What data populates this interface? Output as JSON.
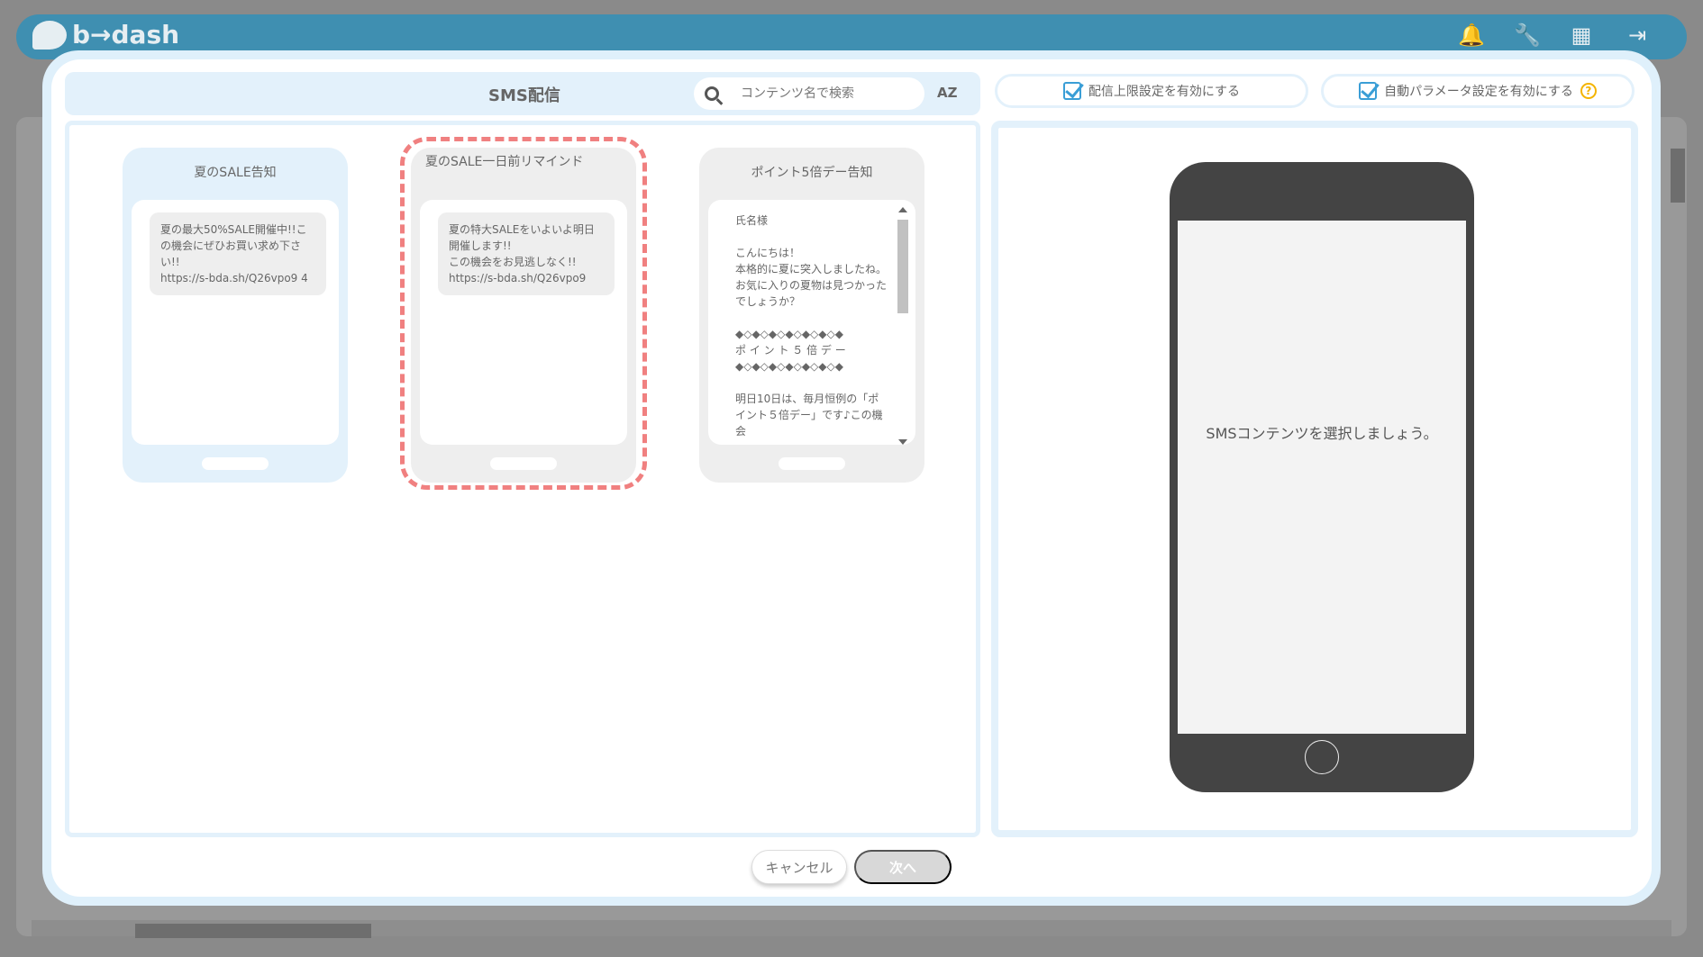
{
  "app": {
    "logo_text": "b→dash"
  },
  "modal": {
    "title": "SMS配信",
    "search": {
      "placeholder": "コンテンツ名で検索",
      "value": ""
    },
    "sort_label": "AZ",
    "toggles": [
      {
        "label": "配信上限設定を有効にする",
        "checked": true
      },
      {
        "label": "自動パラメータ設定を有効にする",
        "checked": true,
        "help": "?"
      }
    ],
    "cards": [
      {
        "title": "夏のSALE告知",
        "message": "夏の最大50%SALE開催中!!この機会にぜひお買い求め下さい!!\nhttps://s-bda.sh/Q26vpo9 4"
      },
      {
        "title": "夏のSALE一日前リマインド",
        "message": "夏の特大SALEをいよいよ明日開催します!!\nこの機会をお見逃しなく!!\nhttps://s-bda.sh/Q26vpo9",
        "selected": true
      },
      {
        "title": "ポイント5倍デー告知",
        "message": "氏名様\n\nこんにちは！\n本格的に夏に突入しましたね。お気に入りの夏物は見つかったでしょうか？\n\n◆◇◆◇◆◇◆◇◆◇◆◇◆\nポ イ ン ト ５ 倍 デ ー\n◆◇◆◇◆◇◆◇◆◇◆◇◆\n\n明日10日は、毎月恒例の「ポイント５倍デー」です♪この機会"
      }
    ],
    "preview_message": "SMSコンテンツを選択しましょう。",
    "buttons": {
      "cancel": "キャンセル",
      "next": "次へ"
    }
  }
}
